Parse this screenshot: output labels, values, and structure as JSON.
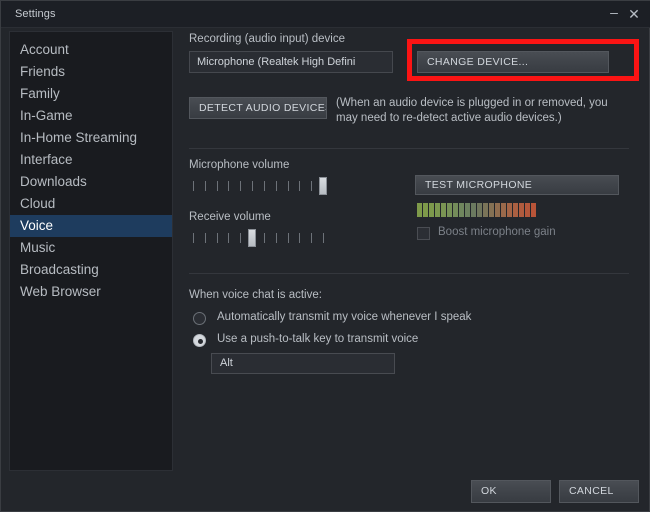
{
  "window": {
    "title": "Settings",
    "minimize_icon": "minimize-icon",
    "minimize_glyph": "–",
    "close_icon": "close-icon",
    "close_glyph": "✕"
  },
  "sidebar": {
    "items": [
      {
        "label": "Account",
        "selected": false
      },
      {
        "label": "Friends",
        "selected": false
      },
      {
        "label": "Family",
        "selected": false
      },
      {
        "label": "In-Game",
        "selected": false
      },
      {
        "label": "In-Home Streaming",
        "selected": false
      },
      {
        "label": "Interface",
        "selected": false
      },
      {
        "label": "Downloads",
        "selected": false
      },
      {
        "label": "Cloud",
        "selected": false
      },
      {
        "label": "Voice",
        "selected": true
      },
      {
        "label": "Music",
        "selected": false
      },
      {
        "label": "Broadcasting",
        "selected": false
      },
      {
        "label": "Web Browser",
        "selected": false
      }
    ]
  },
  "main": {
    "recording_device_label": "Recording (audio input) device",
    "device_value": "Microphone (Realtek High Defini",
    "change_device_label": "CHANGE DEVICE...",
    "detect_devices_label": "DETECT AUDIO DEVICES",
    "detect_note": "(When an audio device is plugged in or removed, you may need to re-detect active audio devices.)",
    "microphone_volume_label": "Microphone volume",
    "receive_volume_label": "Receive volume",
    "test_microphone_label": "TEST MICROPHONE",
    "boost_gain_label": "Boost microphone gain",
    "boost_gain_checked": false,
    "voice_chat_active_label": "When voice chat is active:",
    "radio_options": [
      {
        "label": "Automatically transmit my voice whenever I speak",
        "selected": false
      },
      {
        "label": "Use a push-to-talk key to transmit voice",
        "selected": true
      }
    ],
    "push_to_talk_key": "Alt"
  },
  "sliders": {
    "microphone_volume": {
      "ticks": 12,
      "handle_index": 11
    },
    "receive_volume": {
      "ticks": 12,
      "handle_index": 5
    }
  },
  "level_meter": {
    "segments": 20,
    "colors": [
      "#7e9a4a",
      "#7e9a4a",
      "#7d9a4c",
      "#7c9850",
      "#7a9553",
      "#779157",
      "#748c5a",
      "#70875e",
      "#6d8160",
      "#6b7a5f",
      "#70765c",
      "#7a7458",
      "#857154",
      "#906d4f",
      "#9a694b",
      "#a46446",
      "#ab6042",
      "#b05b3e",
      "#b4573b",
      "#b85438"
    ]
  },
  "annotation": {
    "highlight_color": "#fb1414",
    "target": "change-device-button"
  },
  "footer": {
    "ok_label": "OK",
    "cancel_label": "CANCEL"
  },
  "colors": {
    "window_bg": "#23262b",
    "sidebar_bg": "#191b1f",
    "selected_item_bg": "#1e3c5e",
    "accent_red": "#fb1414"
  }
}
